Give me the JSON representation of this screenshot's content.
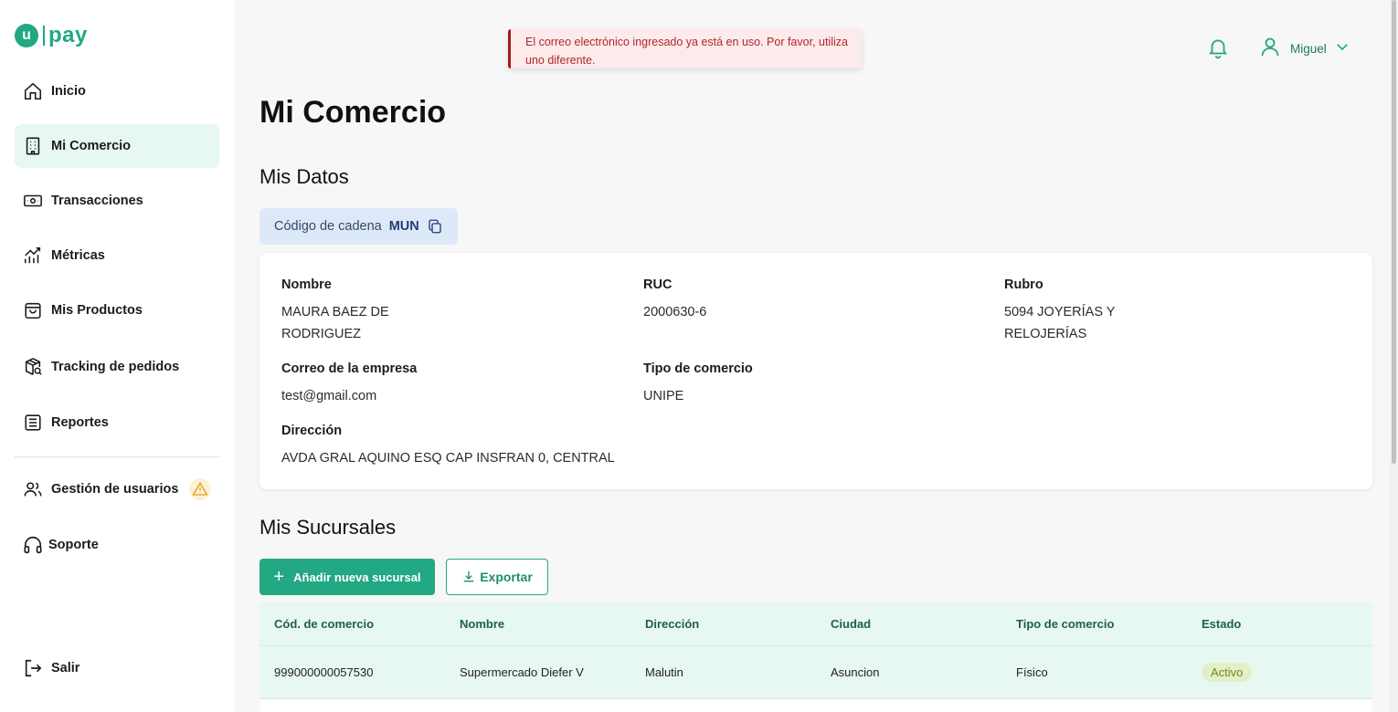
{
  "brand": {
    "badge": "u",
    "name": "pay",
    "color": "#22a883"
  },
  "sidebar": {
    "items": [
      {
        "label": "Inicio",
        "icon": "home-icon"
      },
      {
        "label": "Mi Comercio",
        "icon": "building-icon",
        "active": true
      },
      {
        "label": "Transacciones",
        "icon": "money-icon"
      },
      {
        "label": "Métricas",
        "icon": "chart-icon"
      },
      {
        "label": "Mis Productos",
        "icon": "bag-icon"
      },
      {
        "label": "Tracking de pedidos",
        "icon": "package-search-icon"
      },
      {
        "label": "Reportes",
        "icon": "report-icon"
      },
      {
        "label": "Gestión de usuarios",
        "icon": "users-icon",
        "warning": true
      },
      {
        "label": "Soporte",
        "icon": "headset-icon"
      },
      {
        "label": "Salir",
        "icon": "logout-icon"
      }
    ]
  },
  "toast": {
    "message": "El correo electrónico ingresado ya está en uso. Por favor, utiliza uno diferente."
  },
  "header": {
    "user_name": "Miguel"
  },
  "page": {
    "title": "Mi Comercio",
    "data_section": "Mis Datos",
    "chain_label": "Código de cadena",
    "chain_value": "MUN",
    "branches_section": "Mis Sucursales",
    "add_branch": "Añadir nueva sucursal",
    "export": "Exportar"
  },
  "fields": {
    "nombre": {
      "label": "Nombre",
      "value": "MAURA BAEZ DE RODRIGUEZ"
    },
    "ruc": {
      "label": "RUC",
      "value": "2000630-6"
    },
    "rubro": {
      "label": "Rubro",
      "value": "5094 JOYERÍAS Y RELOJERÍAS"
    },
    "correo": {
      "label": "Correo de la empresa",
      "value": "test@gmail.com"
    },
    "tipo": {
      "label": "Tipo de comercio",
      "value": "UNIPE"
    },
    "direccion": {
      "label": "Dirección",
      "value": "AVDA GRAL AQUINO ESQ CAP INSFRAN 0, CENTRAL"
    }
  },
  "table": {
    "headers": [
      "Cód. de comercio",
      "Nombre",
      "Dirección",
      "Ciudad",
      "Tipo de comercio",
      "Estado"
    ],
    "rows": [
      [
        "999000000057530",
        "Supermercado Diefer V",
        "Malutin",
        "Asuncion",
        "Físico",
        "Activo"
      ]
    ]
  }
}
